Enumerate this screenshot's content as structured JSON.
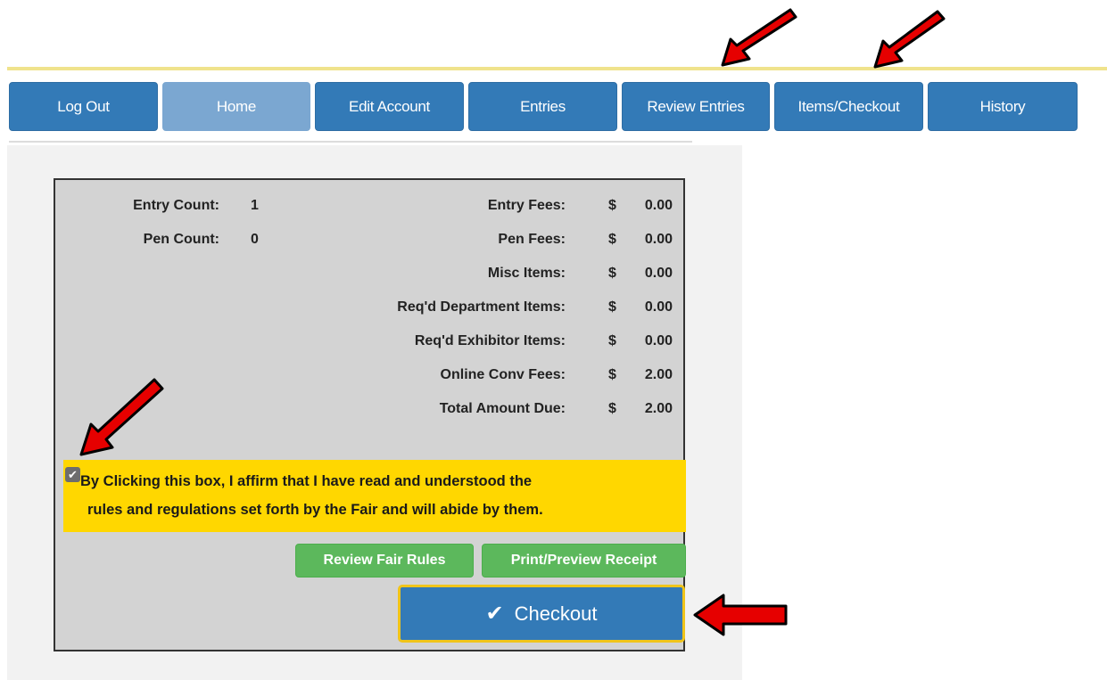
{
  "nav": {
    "items": [
      {
        "label": "Log Out"
      },
      {
        "label": "Home"
      },
      {
        "label": "Edit Account"
      },
      {
        "label": "Entries"
      },
      {
        "label": "Review Entries"
      },
      {
        "label": "Items/Checkout"
      },
      {
        "label": "History"
      }
    ],
    "active": "Home"
  },
  "summary": {
    "entry_count_label": "Entry Count:",
    "entry_count": "1",
    "pen_count_label": "Pen Count:",
    "pen_count": "0",
    "currency": "$",
    "fees": [
      {
        "label": "Entry Fees:",
        "amount": "0.00"
      },
      {
        "label": "Pen Fees:",
        "amount": "0.00"
      },
      {
        "label": "Misc Items:",
        "amount": "0.00"
      },
      {
        "label": "Req'd Department Items:",
        "amount": "0.00"
      },
      {
        "label": "Req'd Exhibitor Items:",
        "amount": "0.00"
      },
      {
        "label": "Online Conv Fees:",
        "amount": "2.00"
      },
      {
        "label": "Total Amount Due:",
        "amount": "2.00"
      }
    ]
  },
  "affirm": {
    "checked": true,
    "line1": "By Clicking this box, I affirm that I have read and understood the",
    "line2": "rules and regulations set forth by the Fair and will abide by them."
  },
  "buttons": {
    "review_rules": "Review Fair Rules",
    "print_receipt": "Print/Preview Receipt",
    "checkout": "Checkout"
  },
  "colors": {
    "nav_blue": "#337ab7",
    "nav_active": "#7ba7d1",
    "affirm_yellow": "#ffd700",
    "green": "#5cb85c",
    "arrow_red": "#e60000"
  }
}
